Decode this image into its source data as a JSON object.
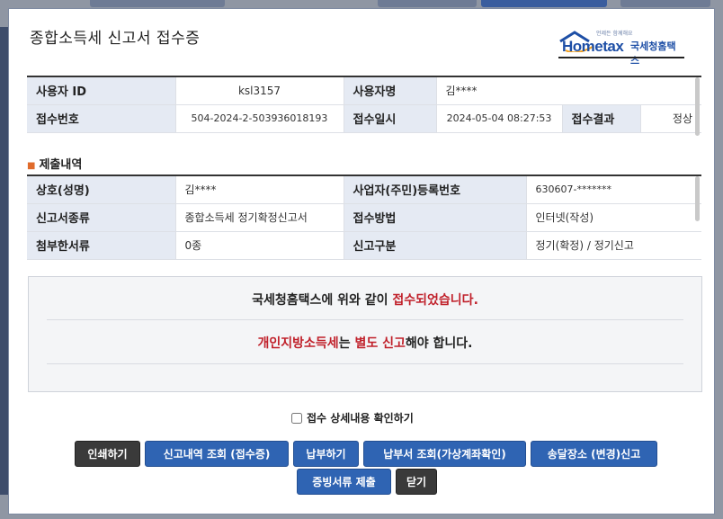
{
  "dialog": {
    "title": "종합소득세 신고서 접수증"
  },
  "logo": {
    "small": "언제든 함께해요",
    "brand": "Hometax",
    "korean": "국세청홈택스"
  },
  "top_table": {
    "user_id_label": "사용자 ID",
    "user_id_value": "ksl3157",
    "user_name_label": "사용자명",
    "user_name_value": "김****",
    "receipt_no_label": "접수번호",
    "receipt_no_value": "504-2024-2-503936018193",
    "receipt_dt_label": "접수일시",
    "receipt_dt_value": "2024-05-04 08:27:53",
    "result_label": "접수결과",
    "result_value": "정상"
  },
  "submission": {
    "heading": "제출내역",
    "trade_name_label": "상호(성명)",
    "trade_name_value": "김****",
    "reg_no_label": "사업자(주민)등록번호",
    "reg_no_value": "630607-*******",
    "report_type_label": "신고서종류",
    "report_type_value": "종합소득세 정기확정신고서",
    "method_label": "접수방법",
    "method_value": "인터넷(작성)",
    "attach_label": "첨부한서류",
    "attach_value": "0종",
    "category_label": "신고구분",
    "category_value": "정기(확정) / 정기신고"
  },
  "notice": {
    "line1_pre": "국세청홈택스에 위와 같이 ",
    "line1_hl": "접수되었습니다.",
    "line2_hl1": "개인지방소득세",
    "line2_mid": "는 ",
    "line2_hl2": "별도 신고",
    "line2_post": "해야 합니다."
  },
  "detail_check": {
    "label": "접수 상세내용 확인하기",
    "checked": false
  },
  "buttons": {
    "print": "인쇄하기",
    "history": "신고내역 조회 (접수증)",
    "pay": "납부하기",
    "bill": "납부서 조회(가상계좌확인)",
    "delivery": "송달장소 (변경)신고",
    "evidence": "증빙서류 제출",
    "close": "닫기"
  },
  "colors": {
    "accent_blue": "#2f64b3",
    "dark_button": "#3a3a3a",
    "highlight_red": "#c0202a",
    "header_cell": "#e5eaf3"
  }
}
